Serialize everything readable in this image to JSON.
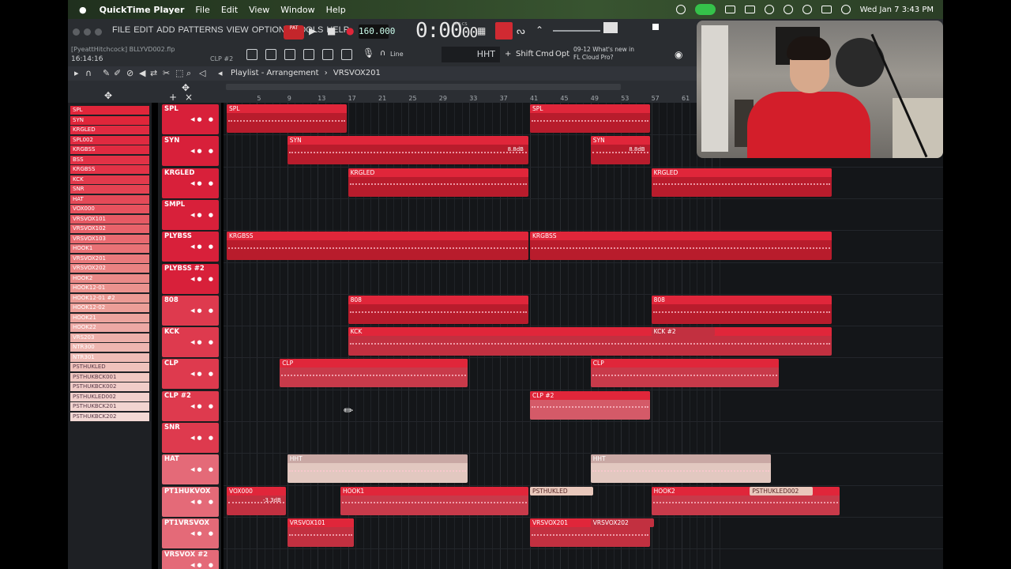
{
  "macbar": {
    "apple": "",
    "app_name": "QuickTime Player",
    "menus": [
      "File",
      "Edit",
      "View",
      "Window",
      "Help"
    ],
    "datetime": "Wed Jan 7  3:43 PM"
  },
  "fl": {
    "menu": [
      "FILE",
      "EDIT",
      "ADD",
      "PATTERNS",
      "VIEW",
      "OPTIONS",
      "TOOLS",
      "HELP"
    ],
    "pat_label": "PAT",
    "tempo": "160.000",
    "time": "0:00",
    "time_frac": "00",
    "time_label": "M:S:CS",
    "project_file": "[PyeattHitchcock] BLLYVD002.flp",
    "project_time": "16:14:16",
    "clip_name": "CLP #2",
    "snap": "Line",
    "channel": "HHT",
    "keys": [
      "Shift",
      "Cmd",
      "Opt"
    ],
    "news_date": "09-12",
    "news_text": "What's new in FL Cloud Pro?"
  },
  "playlist": {
    "title": "Playlist - Arrangement",
    "pattern": "VRSVOX201",
    "ruler": [
      "5",
      "9",
      "13",
      "17",
      "21",
      "25",
      "29",
      "33",
      "37",
      "41",
      "45",
      "49",
      "53",
      "57",
      "61"
    ]
  },
  "picker": [
    "SPL",
    "SYN",
    "KRGLED",
    "SPL002",
    "KRGBSS",
    "BSS",
    "KRGBSS",
    "KCK",
    "SNR",
    "HAT",
    "VOX000",
    "VRSVOX101",
    "VRSVOX102",
    "VRSVOX103",
    "HOOK1",
    "VRSVOX201",
    "VRSVOX202",
    "HOOK2",
    "HOOK12-01",
    "HOOK12-01 #2",
    "HOOK12-02",
    "HOOK21",
    "HOOK22",
    "VRS203",
    "NTR300",
    "NTR301",
    "PSTHUKLED",
    "PSTHUKBCK001",
    "PSTHUKBCK002",
    "PSTHUKLED002",
    "PSTHUKBCK201",
    "PSTHUKBCK202"
  ],
  "tracks": [
    "SPL",
    "SYN",
    "KRGLED",
    "SMPL",
    "PLYBSS",
    "PLYBSS #2",
    "808",
    "KCK",
    "CLP",
    "CLP #2",
    "SNR",
    "HAT",
    "PT1HUKVOX",
    "PT1VRSVOX",
    "VRSVOX #2"
  ],
  "clips": {
    "spl": "SPL",
    "syn": "SYN",
    "syn_db": "8.8dB",
    "krgled": "KRGLED",
    "krgbss": "KRGBSS",
    "bss": "BSS",
    "b808": "808",
    "kck": "KCK",
    "kck2": "KCK #2",
    "clp": "CLP",
    "clp2": "CLP #2",
    "hht": "HHT",
    "vox000": "VOX000",
    "vox_db": "-3.3dB",
    "hook1": "HOOK1",
    "psthukled": "PSTHUKLED",
    "hook2": "HOOK2",
    "psthukled002": "PSTHUKLED002",
    "vrsvox101": "VRSVOX101",
    "vrsvox201": "VRSVOX201",
    "vrsvox202": "VRSVOX202"
  },
  "colors": {
    "accent": "#e0263a",
    "clip_dark": "#7a1420",
    "pink": "#e8a0a8",
    "beige": "#e9d2cc"
  }
}
